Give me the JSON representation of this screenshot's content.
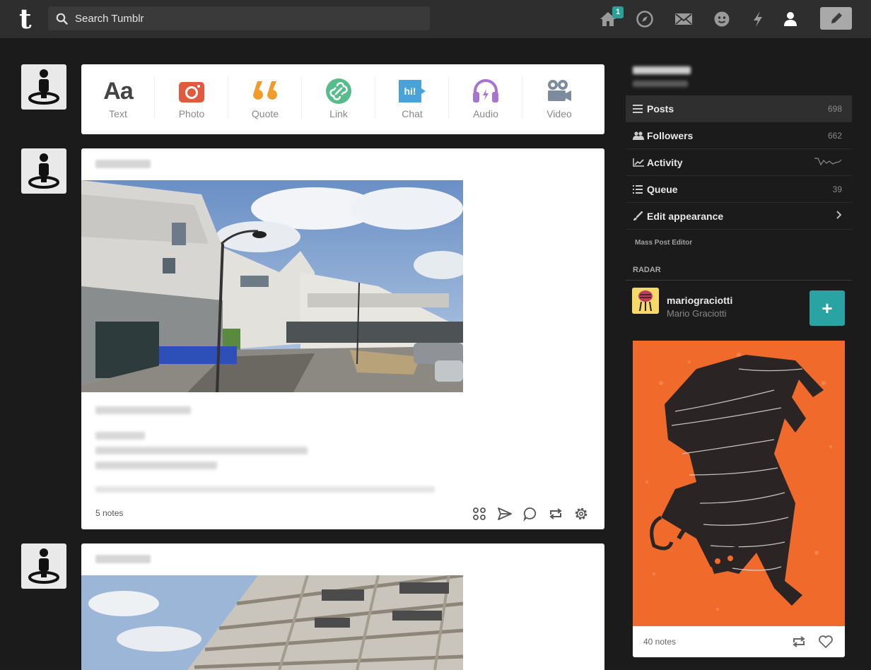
{
  "header": {
    "logo": "t",
    "search_placeholder": "Search Tumblr",
    "home_badge": "1"
  },
  "composer": {
    "types": [
      {
        "label": "Text",
        "icon": "text-icon"
      },
      {
        "label": "Photo",
        "icon": "camera-icon"
      },
      {
        "label": "Quote",
        "icon": "quote-icon"
      },
      {
        "label": "Link",
        "icon": "link-icon"
      },
      {
        "label": "Chat",
        "icon": "chat-icon"
      },
      {
        "label": "Audio",
        "icon": "headphones-icon"
      },
      {
        "label": "Video",
        "icon": "video-camera-icon"
      }
    ],
    "chat_icon_text": "hi!"
  },
  "posts": [
    {
      "notes": "5 notes"
    }
  ],
  "sidebar": {
    "items": [
      {
        "label": "Posts",
        "count": "698"
      },
      {
        "label": "Followers",
        "count": "662"
      },
      {
        "label": "Activity",
        "count": ""
      },
      {
        "label": "Queue",
        "count": "39"
      },
      {
        "label": "Edit appearance",
        "count": ""
      }
    ],
    "mass_post_editor": "Mass Post Editor",
    "radar_heading": "RADAR",
    "radar": {
      "blog": "mariograciotti",
      "title": "Mario Graciotti",
      "follow_label": "+",
      "notes": "40 notes"
    }
  },
  "colors": {
    "background": "#1b1b1b",
    "topbar": "#2e2e2e",
    "accent": "#2aa4a3",
    "photo": "#e05a3b",
    "quote": "#f09b2a",
    "link": "#56bc8a",
    "chat": "#4aa3d8",
    "audio": "#a774d0",
    "video": "#7d8c9c"
  }
}
